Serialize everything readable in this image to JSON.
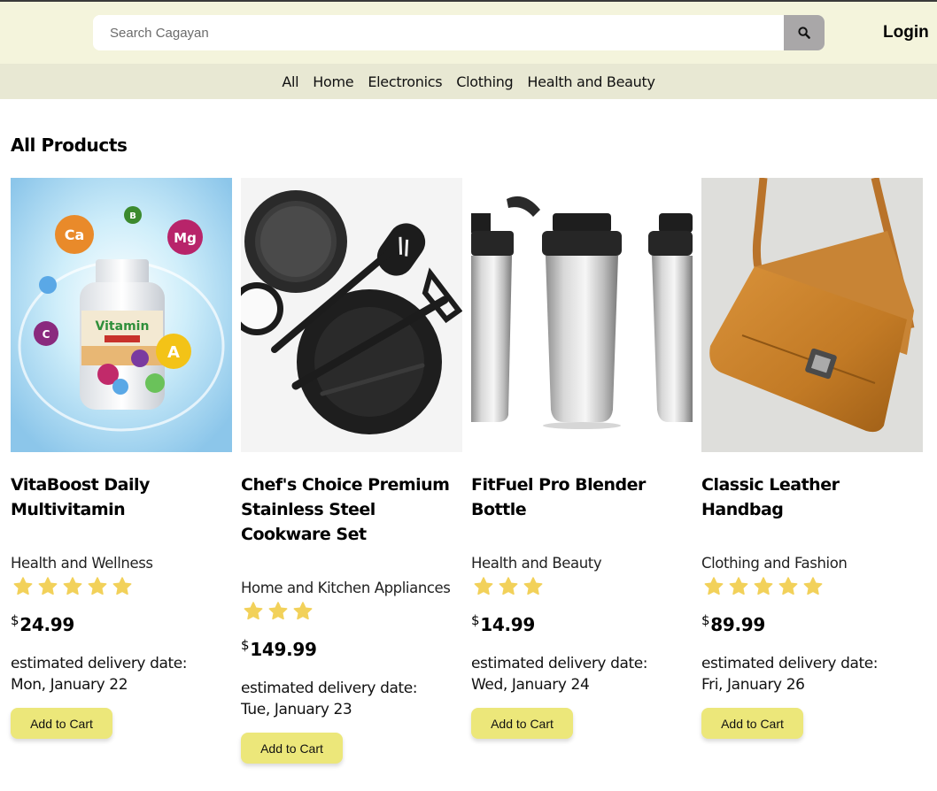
{
  "search": {
    "placeholder": "Search Cagayan"
  },
  "header": {
    "login_label": "Login"
  },
  "categories": [
    "All",
    "Home",
    "Electronics",
    "Clothing",
    "Health and Beauty"
  ],
  "section_title": "All Products",
  "colors": {
    "header_bg": "#f4f4dc",
    "nav_bg": "#e8e8d3",
    "star": "#f2d15a",
    "button": "#ece77a",
    "search_button": "#a9a7a8"
  },
  "currency_symbol": "$",
  "delivery_label": "estimated delivery date:",
  "add_to_cart_label": "Add to Cart",
  "products": [
    {
      "name": "VitaBoost Daily Multivitamin",
      "category": "Health and Wellness",
      "rating": 5,
      "price": "24.99",
      "delivery": "Mon, January 22"
    },
    {
      "name": "Chef's Choice Premium Stainless Steel Cookware Set",
      "category": "Home and Kitchen Appliances",
      "rating": 3,
      "price": "149.99",
      "delivery": "Tue, January 23"
    },
    {
      "name": "FitFuel Pro Blender Bottle",
      "category": "Health and Beauty",
      "rating": 3,
      "price": "14.99",
      "delivery": "Wed, January 24"
    },
    {
      "name": "Classic Leather Handbag",
      "category": "Clothing and Fashion",
      "rating": 5,
      "price": "89.99",
      "delivery": "Fri, January 26"
    }
  ]
}
